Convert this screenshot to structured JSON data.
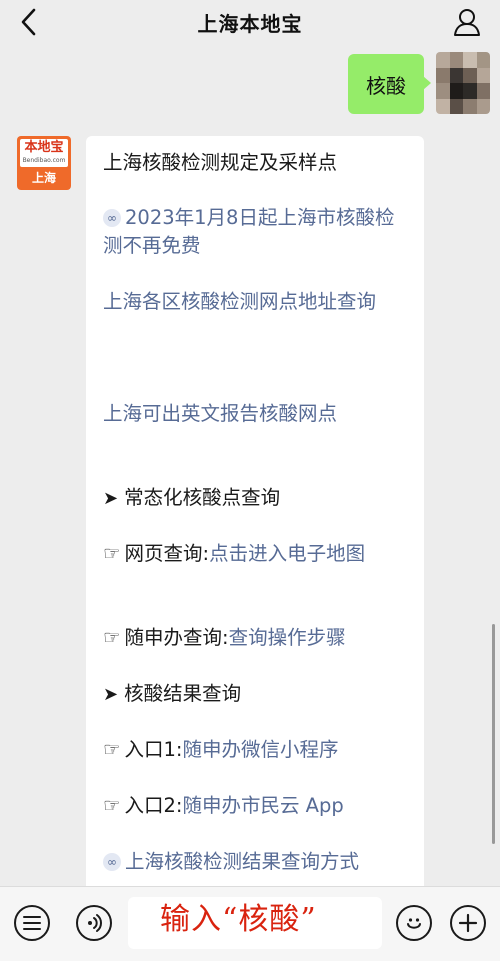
{
  "header": {
    "title": "上海本地宝"
  },
  "outgoing_message": {
    "text": "核酸"
  },
  "bot": {
    "avatar_brand": "本地宝",
    "avatar_site": "Bendibao.com",
    "avatar_city": "上海"
  },
  "reply": {
    "heading": "上海核酸检测规定及采样点",
    "news_link": "2023年1月8日起上海市核酸检测不再免费",
    "district_link": "上海各区核酸检测网点地址查询",
    "english_report_link": "上海可出英文报告核酸网点",
    "section_regular": "常态化核酸点查询",
    "web_query_label": "网页查询:",
    "web_query_link": "点击进入电子地图",
    "suishenban_label": "随申办查询:",
    "suishenban_link": "查询操作步骤",
    "section_result": "核酸结果查询",
    "entry1_label": "入口1:",
    "entry1_link": "随申办微信小程序",
    "entry2_label": "入口2:",
    "entry2_link": "随申办市民云 App",
    "result_method_link": "上海核酸检测结果查询方式"
  },
  "input_bar": {
    "annotation": "输入“核酸”"
  },
  "colors": {
    "background": "#ededed",
    "outgoing_bubble": "#95ec69",
    "link": "#576b95",
    "annotation": "#d9230f",
    "brand_orange": "#ef6a2a"
  }
}
